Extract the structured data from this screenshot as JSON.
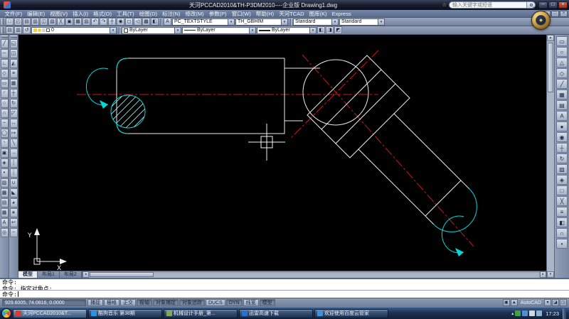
{
  "titlebar": {
    "title": "天河PCCAD2010&TH-P3DM2010----企业版  Drawing1.dwg",
    "search_placeholder": "输入关键字或短语",
    "min": "─",
    "max": "□",
    "close": "×"
  },
  "mdi": {
    "min": "─",
    "restore": "□",
    "close": "×"
  },
  "menu": {
    "items": [
      {
        "name": "menu-file",
        "label": "文件(F)"
      },
      {
        "name": "menu-edit",
        "label": "编辑(E)"
      },
      {
        "name": "menu-view",
        "label": "视图(V)"
      },
      {
        "name": "menu-insert",
        "label": "插入(I)"
      },
      {
        "name": "menu-format",
        "label": "格式(O)"
      },
      {
        "name": "menu-tools",
        "label": "工具(T)"
      },
      {
        "name": "menu-draw",
        "label": "绘图(D)"
      },
      {
        "name": "menu-dimension",
        "label": "标注(N)"
      },
      {
        "name": "menu-modify",
        "label": "修改(M)"
      },
      {
        "name": "menu-parametric",
        "label": "参数(P)"
      },
      {
        "name": "menu-window",
        "label": "窗口(W)"
      },
      {
        "name": "menu-help",
        "label": "帮助(H)"
      },
      {
        "name": "menu-tianhe-tcad",
        "label": "天河TCAD"
      },
      {
        "name": "menu-library",
        "label": "图库(K)"
      },
      {
        "name": "menu-express",
        "label": "Express"
      }
    ]
  },
  "toolbar1": {
    "icons": [
      {
        "name": "new-icon",
        "glyph": "□"
      },
      {
        "name": "open-icon",
        "glyph": "◰"
      },
      {
        "name": "save-icon",
        "glyph": "▤"
      },
      {
        "name": "plot-icon",
        "glyph": "▥"
      },
      {
        "name": "plot-preview-icon",
        "glyph": "◫"
      },
      {
        "name": "publish-icon",
        "glyph": "▧"
      },
      {
        "name": "cut-icon",
        "glyph": "╳"
      },
      {
        "name": "copy-icon",
        "glyph": "▣"
      },
      {
        "name": "paste-icon",
        "glyph": "▦"
      },
      {
        "name": "match-properties-icon",
        "glyph": "▨"
      },
      {
        "name": "undo-icon",
        "glyph": "↶"
      },
      {
        "name": "redo-icon",
        "glyph": "↷"
      },
      {
        "name": "pan-icon",
        "glyph": "┼"
      },
      {
        "name": "zoom-realtime-icon",
        "glyph": "◉"
      },
      {
        "name": "zoom-window-icon",
        "glyph": "◻"
      },
      {
        "name": "zoom-previous-icon",
        "glyph": "◁"
      },
      {
        "name": "properties-icon",
        "glyph": "▩"
      },
      {
        "name": "designcenter-icon",
        "glyph": "◧"
      }
    ],
    "text_style_icon": "A",
    "text_style": "PC_TEXTSTYLE",
    "dim_style": "TH_GBHIM",
    "table_style": "Standard",
    "mleader_style": "Standard"
  },
  "toolbar2": {
    "icons_a": [
      {
        "name": "layer-properties-icon",
        "glyph": "▤"
      },
      {
        "name": "layer-filter-icon",
        "glyph": "▥"
      },
      {
        "name": "layer-previous-icon",
        "glyph": "↺"
      }
    ],
    "layer_value": "0",
    "make-object-layer-glyph": "◧",
    "color_value": "ByLayer",
    "linetype_value": "ByLayer",
    "lineweight_value": "ByLayer",
    "icons_b": [
      {
        "name": "make-object-layer-icon",
        "glyph": "◧"
      },
      {
        "name": "layer-isolate-icon",
        "glyph": "◨"
      },
      {
        "name": "layer-off-icon",
        "glyph": "◩"
      }
    ]
  },
  "draw_toolbar": {
    "icons": [
      {
        "name": "line-icon",
        "glyph": "╱"
      },
      {
        "name": "construction-line-icon",
        "glyph": "─"
      },
      {
        "name": "polyline-icon",
        "glyph": "∟"
      },
      {
        "name": "polygon-icon",
        "glyph": "◇"
      },
      {
        "name": "rectangle-icon",
        "glyph": "▭"
      },
      {
        "name": "arc-icon",
        "glyph": "◜"
      },
      {
        "name": "circle-icon",
        "glyph": "○"
      },
      {
        "name": "revision-cloud-icon",
        "glyph": "∩"
      },
      {
        "name": "spline-icon",
        "glyph": "~"
      },
      {
        "name": "ellipse-icon",
        "glyph": "◯"
      },
      {
        "name": "ellipse-arc-icon",
        "glyph": "◝"
      },
      {
        "name": "insert-block-icon",
        "glyph": "▣"
      },
      {
        "name": "make-block-icon",
        "glyph": "◈"
      },
      {
        "name": "point-icon",
        "glyph": "•"
      },
      {
        "name": "hatch-icon",
        "glyph": "▨"
      },
      {
        "name": "gradient-icon",
        "glyph": "▩"
      },
      {
        "name": "region-icon",
        "glyph": "▤"
      },
      {
        "name": "table-icon",
        "glyph": "▦"
      },
      {
        "name": "multiline-text-icon",
        "glyph": "A"
      },
      {
        "name": "donut-icon",
        "glyph": "◎"
      }
    ]
  },
  "modify_toolbar": {
    "icons": [
      {
        "name": "erase-icon",
        "glyph": "◱"
      },
      {
        "name": "copy-object-icon",
        "glyph": "◫"
      },
      {
        "name": "mirror-icon",
        "glyph": "◭"
      },
      {
        "name": "offset-icon",
        "glyph": "≡"
      },
      {
        "name": "array-icon",
        "glyph": "▦"
      },
      {
        "name": "move-icon",
        "glyph": "┼"
      },
      {
        "name": "rotate-icon",
        "glyph": "↻"
      },
      {
        "name": "scale-icon",
        "glyph": "◸"
      },
      {
        "name": "stretch-icon",
        "glyph": "↔"
      },
      {
        "name": "lengthen-icon",
        "glyph": "↦"
      },
      {
        "name": "trim-icon",
        "glyph": "╲"
      },
      {
        "name": "extend-icon",
        "glyph": "→"
      },
      {
        "name": "break-at-point-icon",
        "glyph": "┆"
      },
      {
        "name": "break-icon",
        "glyph": "┊"
      },
      {
        "name": "join-icon",
        "glyph": "∪"
      },
      {
        "name": "chamfer-icon",
        "glyph": "◣"
      },
      {
        "name": "fillet-icon",
        "glyph": "◕"
      },
      {
        "name": "explode-icon",
        "glyph": "∗"
      },
      {
        "name": "reverse-icon",
        "glyph": "↩"
      },
      {
        "name": "blend-icon",
        "glyph": "~"
      }
    ]
  },
  "right_toolbar": {
    "icons": [
      {
        "name": "right-tool-1-icon",
        "glyph": "▭"
      },
      {
        "name": "right-tool-2-icon",
        "glyph": "○"
      },
      {
        "name": "right-tool-3-icon",
        "glyph": "△"
      },
      {
        "name": "right-tool-4-icon",
        "glyph": "◇"
      },
      {
        "name": "right-tool-5-icon",
        "glyph": "╱"
      },
      {
        "name": "right-tool-6-icon",
        "glyph": "▦"
      },
      {
        "name": "right-tool-7-icon",
        "glyph": "▤"
      },
      {
        "name": "right-tool-8-icon",
        "glyph": "A"
      },
      {
        "name": "right-tool-9-icon",
        "glyph": "●"
      },
      {
        "name": "right-tool-10-icon",
        "glyph": "◉"
      },
      {
        "name": "right-tool-11-icon",
        "glyph": "┼"
      },
      {
        "name": "right-tool-12-icon",
        "glyph": "↻"
      },
      {
        "name": "right-tool-13-icon",
        "glyph": "▨"
      },
      {
        "name": "right-tool-14-icon",
        "glyph": "◈"
      },
      {
        "name": "right-tool-15-icon",
        "glyph": "□"
      },
      {
        "name": "right-tool-16-icon",
        "glyph": "╳"
      },
      {
        "name": "right-tool-17-icon",
        "glyph": "≡"
      },
      {
        "name": "right-tool-18-icon",
        "glyph": "◧"
      },
      {
        "name": "right-tool-19-icon",
        "glyph": "∩"
      },
      {
        "name": "right-tool-20-icon",
        "glyph": "•"
      }
    ]
  },
  "canvas": {
    "tabs": [
      {
        "name": "tab-model",
        "label": "模型",
        "active": true
      },
      {
        "name": "tab-layout1",
        "label": "布局1"
      },
      {
        "name": "tab-layout2",
        "label": "布局2"
      }
    ],
    "ucs_x": "X",
    "ucs_y": "Y",
    "colors": {
      "line": "#ececec",
      "accent": "#00d9d9",
      "centerline": "#c21d1d",
      "hatch": "#bce9e9",
      "crosshair": "#f5f5f5"
    }
  },
  "command": {
    "history": [
      "命令:",
      "命令: 指定对角点:"
    ],
    "prompt": "命令:"
  },
  "statusbar": {
    "coords": "929.6005, 74.0816, 0.0000",
    "toggles": [
      {
        "name": "toggle-snap",
        "label": "捕捉",
        "on": false
      },
      {
        "name": "toggle-grid",
        "label": "栅格",
        "on": false
      },
      {
        "name": "toggle-ortho",
        "label": "正交",
        "on": false
      },
      {
        "name": "toggle-polar",
        "label": "极轴",
        "on": true
      },
      {
        "name": "toggle-osnap",
        "label": "对象捕捉",
        "on": true
      },
      {
        "name": "toggle-otrack",
        "label": "对象追踪",
        "on": true
      },
      {
        "name": "toggle-ducs",
        "label": "DUCS",
        "on": false
      },
      {
        "name": "toggle-dyn",
        "label": "DYN",
        "on": true
      },
      {
        "name": "toggle-lwt",
        "label": "线宽",
        "on": false
      },
      {
        "name": "toggle-model",
        "label": "模型",
        "on": true
      }
    ],
    "right_icons_a": [
      {
        "name": "model-paper-icon",
        "glyph": "▣"
      },
      {
        "name": "annotation-scale-icon",
        "glyph": "▲"
      }
    ],
    "workspace": "AutoCAD",
    "right_icons_b": [
      {
        "name": "workspace-menu-icon",
        "glyph": "▾"
      },
      {
        "name": "toolbar-lock-icon",
        "glyph": "◪"
      },
      {
        "name": "clean-screen-icon",
        "glyph": "◳"
      }
    ]
  },
  "taskbar": {
    "tasks": [
      {
        "name": "taskbar-item-pccad",
        "label": "天河PCCAD2010&T...",
        "color": "#d04038",
        "active": true
      },
      {
        "name": "taskbar-item-kugou",
        "label": "酷狗音乐 第38期",
        "color": "#2f8fe0"
      },
      {
        "name": "taskbar-item-manual",
        "label": "机械设计手册_第...",
        "color": "#7fa85a"
      },
      {
        "name": "taskbar-item-xunlei",
        "label": "迅雷高速下载",
        "color": "#2b6fd4"
      },
      {
        "name": "taskbar-item-baiduyun",
        "label": "欢迎使用百度云管家",
        "color": "#3f8fdd"
      }
    ],
    "tray_icons": [
      {
        "name": "tray-safety-icon",
        "color": "#43a047"
      },
      {
        "name": "tray-cloud-icon",
        "color": "#4f8fd6"
      },
      {
        "name": "tray-audio-icon",
        "color": "#cfd8e6"
      },
      {
        "name": "tray-network-icon",
        "color": "#8fb2d9"
      }
    ],
    "clock": "17:23"
  }
}
